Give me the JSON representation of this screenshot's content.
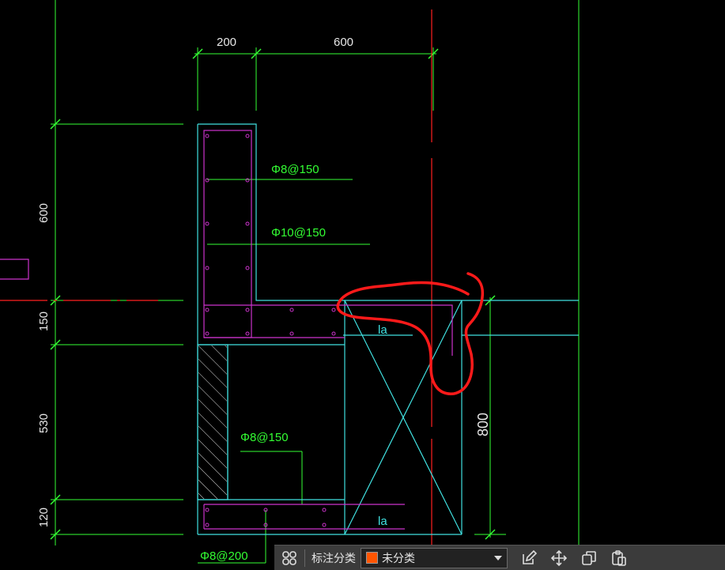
{
  "dimensions": {
    "top_left": "200",
    "top_right": "600",
    "left_1": "600",
    "left_2": "150",
    "left_3": "530",
    "left_4": "120",
    "right": "800"
  },
  "rebar_labels": {
    "r1": "Φ8@150",
    "r2": "Φ10@150",
    "r3": "Φ8@150",
    "r4": "Φ8@200"
  },
  "anchorage_labels": {
    "upper": "la",
    "lower": "la"
  },
  "toolbar": {
    "category_label": "标注分类",
    "category_value": "未分类",
    "swatch_color": "#ff5500",
    "icons": [
      "grid-icon",
      "edit-icon",
      "move-icon",
      "copy-icon",
      "paste-icon"
    ]
  },
  "colors": {
    "dimension": "#33ff33",
    "outline": "#40e0e0",
    "rebar": "#cc33cc",
    "axis": "#ff2020",
    "markup": "#ff1a1a"
  }
}
